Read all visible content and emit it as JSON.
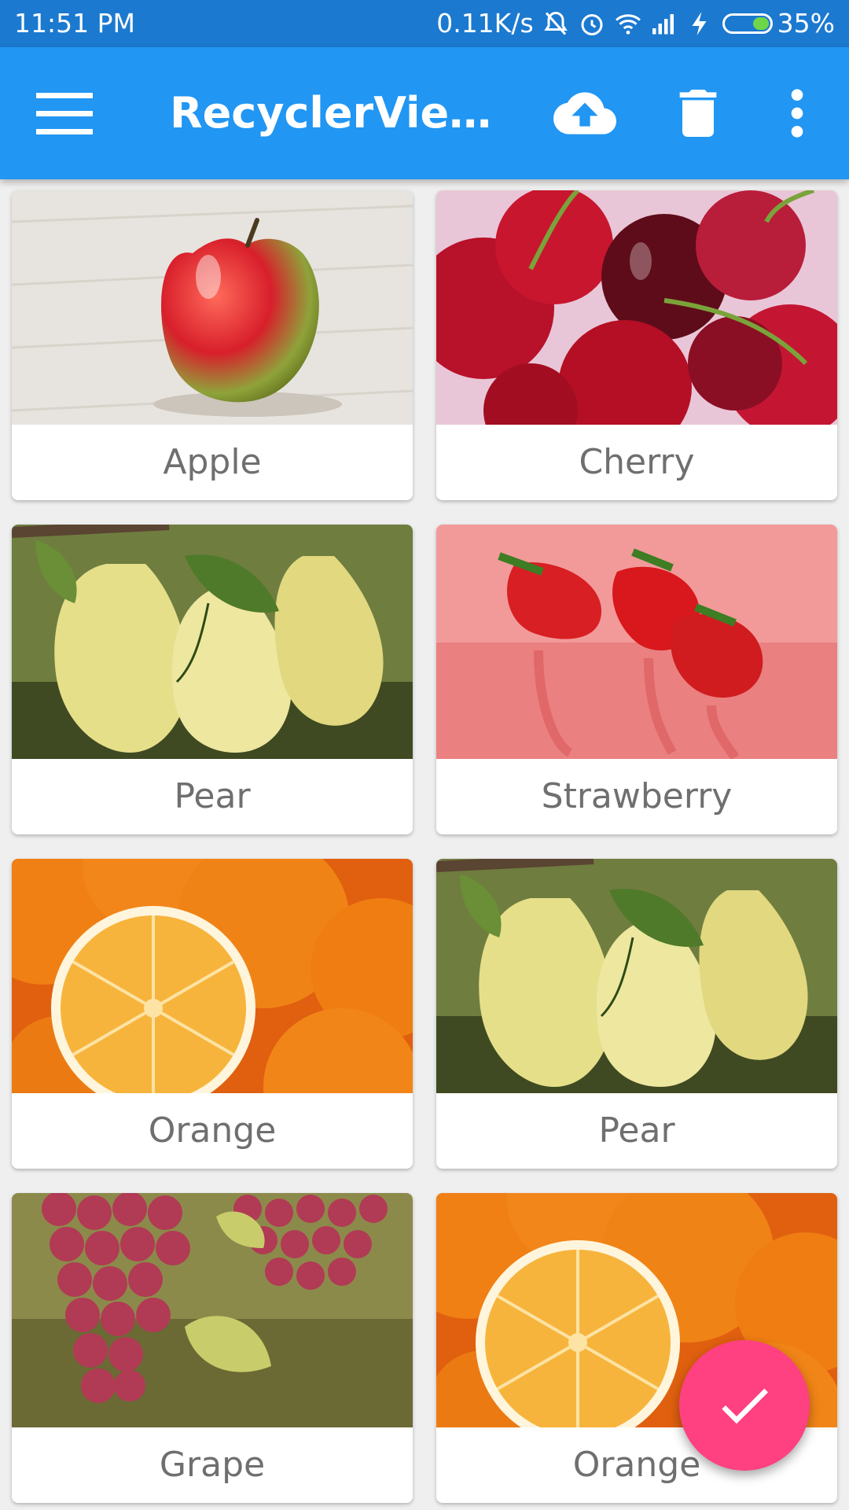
{
  "status_bar": {
    "time": "11:51 PM",
    "net_speed": "0.11K/s",
    "battery": "35%",
    "icons": [
      "mute-icon",
      "alarm-icon",
      "wifi-icon",
      "signal-icon",
      "charging-icon",
      "battery-icon"
    ]
  },
  "app_bar": {
    "title": "RecyclerView...",
    "background": "#2196f3",
    "icons": [
      "menu-icon",
      "cloud-upload-icon",
      "delete-icon",
      "more-vert-icon"
    ]
  },
  "fruits": [
    {
      "label": "Apple"
    },
    {
      "label": "Cherry"
    },
    {
      "label": "Pear"
    },
    {
      "label": "Strawberry"
    },
    {
      "label": "Orange"
    },
    {
      "label": "Pear"
    },
    {
      "label": "Grape"
    },
    {
      "label": "Orange"
    }
  ],
  "fab": {
    "icon": "check-icon",
    "color": "#ff4081"
  }
}
